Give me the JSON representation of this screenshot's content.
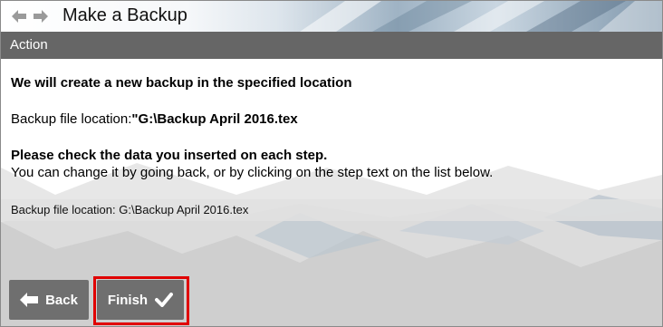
{
  "window": {
    "title": "Make a Backup",
    "section_label": "Action"
  },
  "content": {
    "intro": "We will create a new backup in the specified location",
    "location_label": "Backup file location:",
    "location_value": "\"G:\\Backup April 2016.tex",
    "check_heading": "Please check the data you inserted on each step.",
    "check_detail": "You can change it by going back, or by clicking on the step text on the list below."
  },
  "summary": {
    "items": [
      "Backup file location: G:\\Backup April 2016.tex"
    ]
  },
  "buttons": {
    "back_label": "Back",
    "finish_label": "Finish"
  },
  "colors": {
    "section_bar": "#666666",
    "button": "#6f6f6f",
    "highlight": "#e00000"
  },
  "icons": {
    "nav_back": "arrow-left-icon",
    "nav_forward": "arrow-right-icon",
    "back": "arrow-left-icon",
    "finish": "checkmark-icon"
  }
}
